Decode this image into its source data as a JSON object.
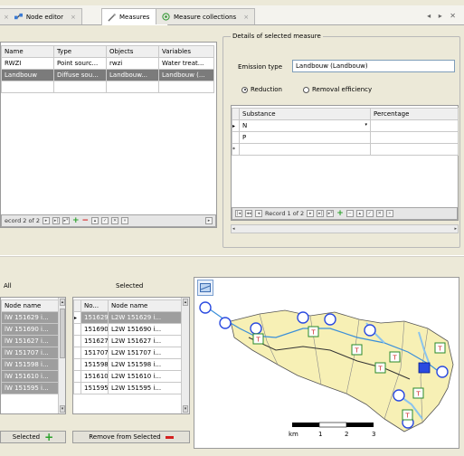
{
  "tabs": [
    {
      "label": "Node editor",
      "icon": "node-editor-icon",
      "active": false
    },
    {
      "label": "Measures",
      "icon": "measures-icon",
      "active": true
    },
    {
      "label": "Measure collections",
      "icon": "measure-collections-icon",
      "active": false
    }
  ],
  "nav_arrows": "◂ ▸ ✕",
  "measures_table": {
    "columns": [
      "Name",
      "Type",
      "Objects",
      "Variables"
    ],
    "rows": [
      [
        "RWZI",
        "Point sourc...",
        "rwzi",
        "Water treat..."
      ],
      [
        "Landbouw",
        "Diffuse sou...",
        "Landbouw...",
        "Landbouw (..."
      ]
    ],
    "record_text": "ecord 2 of 2"
  },
  "details": {
    "title": "Details of selected measure",
    "emission_type_label": "Emission type",
    "emission_type_value": "Landbouw (Landbouw)",
    "reduction_label": "Reduction",
    "removal_label": "Removal efficiency",
    "substance_header": "Substance",
    "percentage_header": "Percentage",
    "substances": [
      "N",
      "P"
    ],
    "record_text": "Record 1 of 2"
  },
  "all_nodes": {
    "label": "All",
    "column": "Node name",
    "rows": [
      "lW 151629 i...",
      "lW 151690 i...",
      "lW 151627 i...",
      "lW 151707 i...",
      "lW 151598 i...",
      "lW 151610 i...",
      "lW 151595 i..."
    ],
    "button_label": "Selected"
  },
  "selected_nodes": {
    "label": "Selected",
    "columns": [
      "No...",
      "Node name"
    ],
    "rows": [
      [
        "151629",
        "L2W 151629 i..."
      ],
      [
        "151690",
        "L2W 151690 i..."
      ],
      [
        "151627",
        "L2W 151627 i..."
      ],
      [
        "151707",
        "L2W 151707 i..."
      ],
      [
        "151598",
        "L2W 151598 i..."
      ],
      [
        "151610",
        "L2W 151610 i..."
      ],
      [
        "151595",
        "L2W 151595 i..."
      ]
    ],
    "remove_label": "Remove from Selected"
  },
  "map": {
    "scale_labels": [
      "km",
      "1",
      "2",
      "3"
    ]
  },
  "colors": {
    "add_green": "#2aa12a",
    "remove_red": "#d42020",
    "catchment": "#f7f0b5",
    "river": "#a8d4f0",
    "node_blue": "#2a4ae0"
  }
}
